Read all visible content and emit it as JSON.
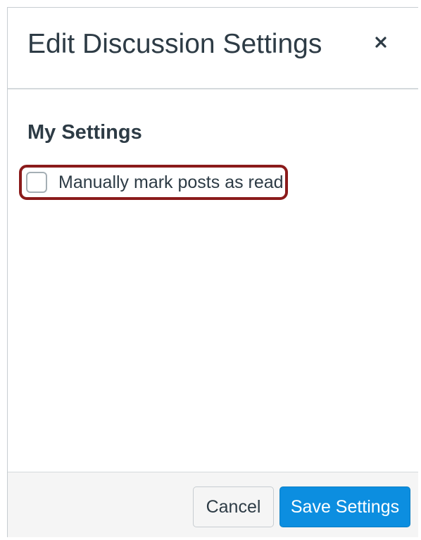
{
  "dialog": {
    "title": "Edit Discussion Settings",
    "close_icon": "close-icon"
  },
  "settings": {
    "section_title": "My Settings",
    "options": [
      {
        "label": "Manually mark posts as read",
        "checked": false,
        "highlighted": true
      }
    ]
  },
  "footer": {
    "cancel_label": "Cancel",
    "save_label": "Save Settings"
  },
  "colors": {
    "primary_button": "#0c8ee0",
    "highlight_border": "#8b1b1b",
    "text": "#2d3b45"
  }
}
